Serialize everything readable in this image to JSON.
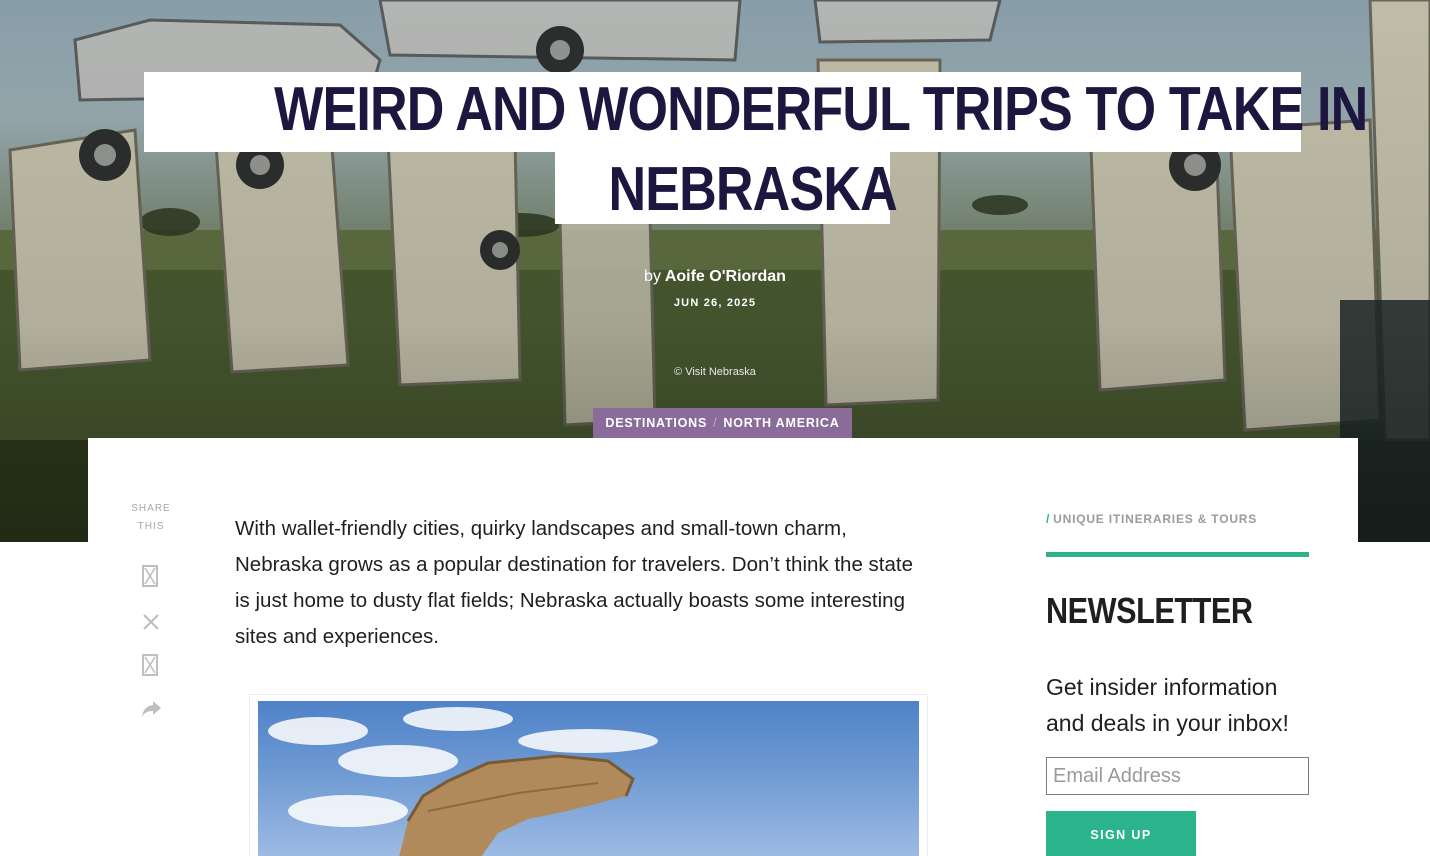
{
  "hero": {
    "title_line1": "WEIRD AND WONDERFUL TRIPS TO TAKE IN",
    "title_line2": "NEBRASKA",
    "byline_prefix": "by",
    "author": "Aoife O'Riordan",
    "date": "JUN 26, 2025",
    "photo_credit": "© Visit Nebraska"
  },
  "categories": {
    "primary": "DESTINATIONS",
    "separator": "/",
    "secondary": "NORTH AMERICA"
  },
  "share": {
    "label_line1": "SHARE",
    "label_line2": "THIS",
    "icons": [
      "facebook-icon",
      "x-twitter-icon",
      "pinterest-icon",
      "share-forward-icon"
    ]
  },
  "article": {
    "intro": "With wallet-friendly cities, quirky landscapes and small-town charm, Nebraska grows as a popular destination for travelers. Don’t think the state is just home to dusty flat fields; Nebraska actually boasts some interesting sites and experiences."
  },
  "sidebar": {
    "tag_slash": "/",
    "tag": "UNIQUE ITINERARIES & TOURS",
    "newsletter_title": "NEWSLETTER",
    "newsletter_desc": "Get insider information and deals in your inbox!",
    "email_placeholder": "Email Address",
    "signup_label": "SIGN UP"
  },
  "colors": {
    "accent_green": "#2bb38c",
    "category_purple": "#8b6b9a",
    "title_navy": "#1d1740"
  }
}
